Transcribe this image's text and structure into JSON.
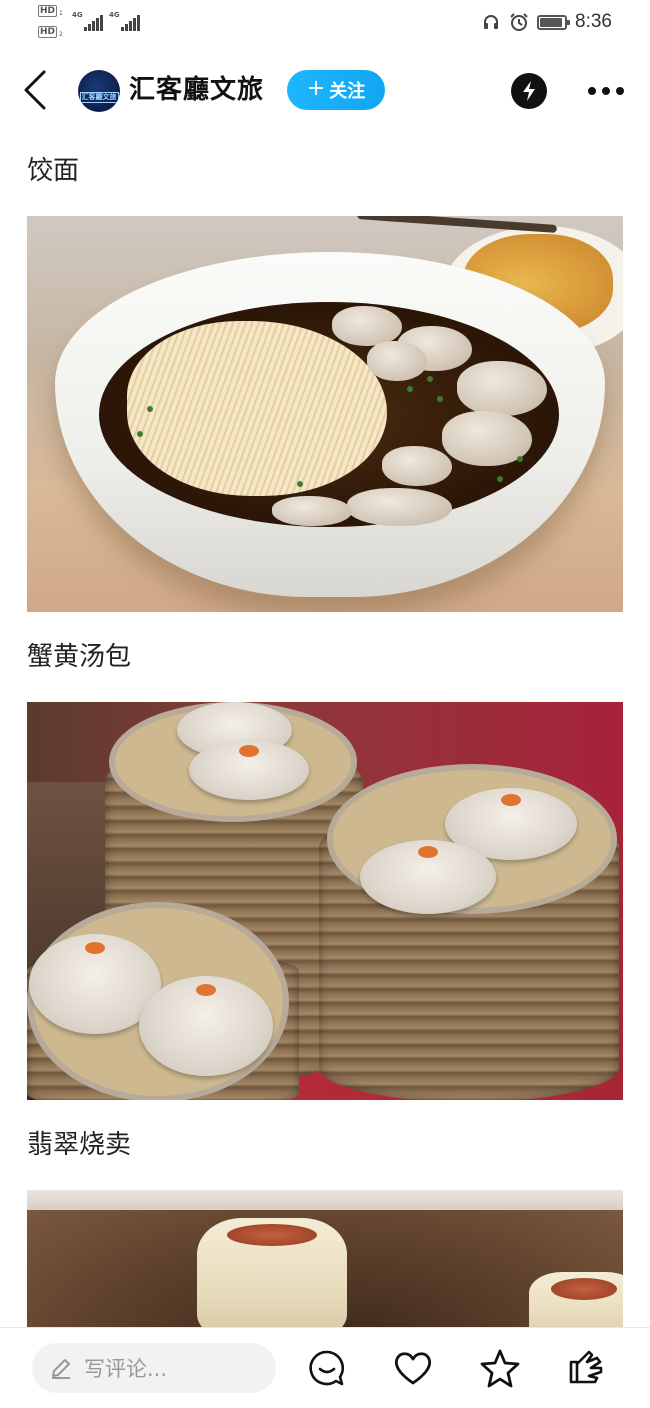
{
  "status_bar": {
    "sim1_label": "HD",
    "sim1_index": "1",
    "sim2_label": "HD",
    "sim2_index": "2",
    "network1": "4G",
    "network2": "4G",
    "time": "8:36",
    "battery_level": 0.9,
    "icons": [
      "headphones-icon",
      "alarm-icon",
      "battery-icon"
    ]
  },
  "header": {
    "account_name": "汇客廳文旅",
    "avatar_text": "汇客廳文旅",
    "follow_label": "关注",
    "follow_plus": "+",
    "icons": [
      "back-arrow-icon",
      "flash-icon",
      "more-dots-icon"
    ]
  },
  "article": {
    "sections": [
      {
        "title": "饺面",
        "image": "wonton-noodle-soup-photo"
      },
      {
        "title": "蟹黄汤包",
        "image": "crab-roe-soup-dumplings-photo"
      },
      {
        "title": "翡翠烧卖",
        "image": "jade-shaomai-photo"
      }
    ]
  },
  "bottom_bar": {
    "comment_placeholder": "写评论...",
    "icons": [
      "pencil-icon",
      "comment-bubble-icon",
      "heart-icon",
      "star-icon",
      "share-icon"
    ]
  },
  "colors": {
    "follow_button": "#10a6f0",
    "text_primary": "#222222",
    "placeholder": "#999999",
    "comment_box_bg": "#f1f2f3"
  }
}
